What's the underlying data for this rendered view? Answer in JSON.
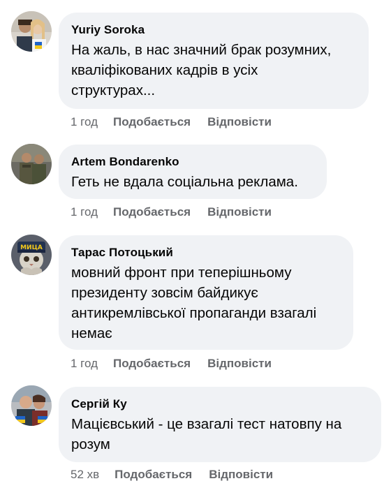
{
  "comments": [
    {
      "author": "Yuriy Soroka",
      "text": "На жаль, в нас значний брак розумних,\nкваліфікованих кадрів в усіх\nструктурах...",
      "time": "1 год",
      "like_label": "Подобається",
      "reply_label": "Відповісти"
    },
    {
      "author": "Artem Bondarenko",
      "text": "Геть не вдала соціальна реклама.",
      "time": "1 год",
      "like_label": "Подобається",
      "reply_label": "Відповісти"
    },
    {
      "author": "Тарас Потоцький",
      "text": "мовний фронт при теперішньому\nпрезиденту зовсім байдикує\nантикремлівської пропаганди взагалі\nнемає",
      "time": "1 год",
      "like_label": "Подобається",
      "reply_label": "Відповісти",
      "avatar_cap_text": "МИЦА"
    },
    {
      "author": "Сергій Ку",
      "text": "Мацієвський - це взагалі тест натовпу на\nрозум",
      "time": "52 хв",
      "like_label": "Подобається",
      "reply_label": "Відповісти"
    }
  ],
  "colors": {
    "bubble": "#f0f2f5",
    "meta": "#65676b",
    "text": "#050505"
  }
}
